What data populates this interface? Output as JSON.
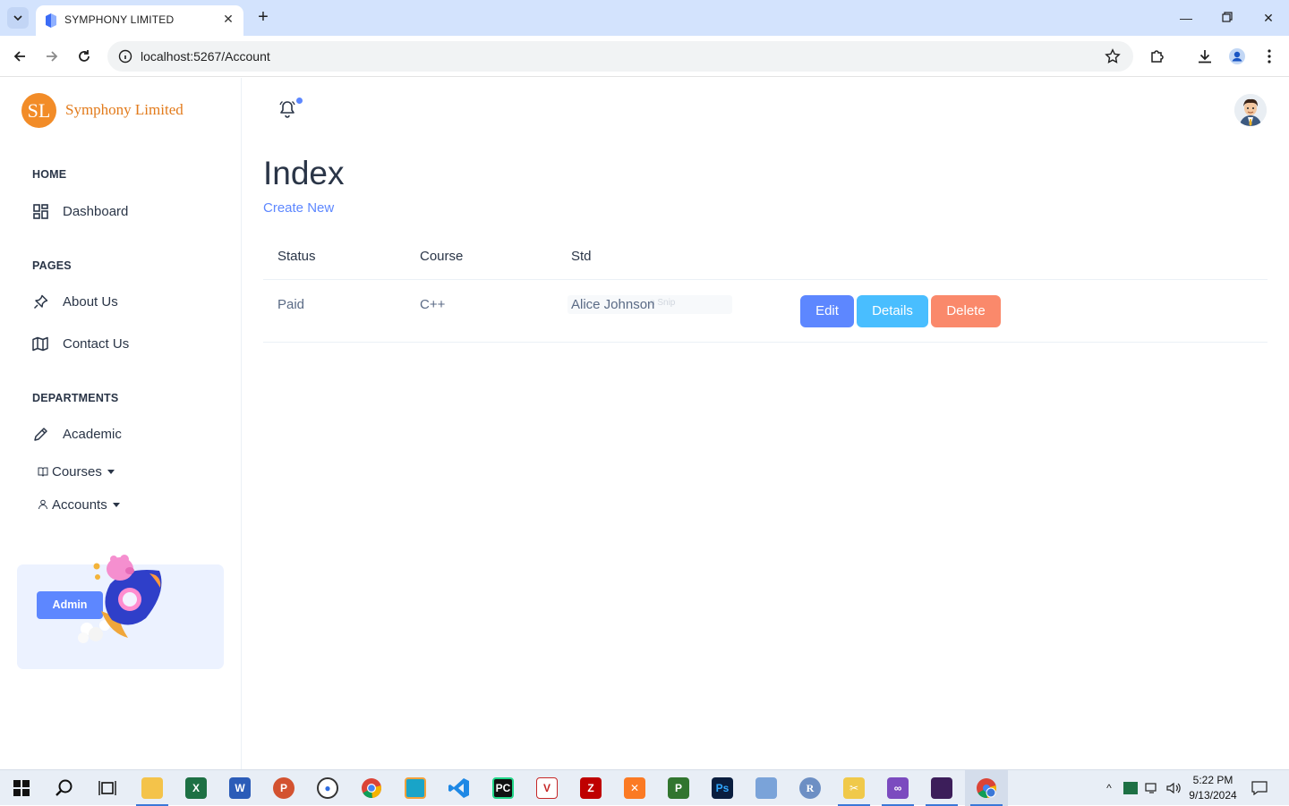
{
  "browser": {
    "tab_title": "SYMPHONY LIMITED",
    "url": "localhost:5267/Account"
  },
  "brand": {
    "initials": "SL",
    "name": "Symphony Limited"
  },
  "sidebar": {
    "sections": [
      {
        "caption": "HOME",
        "items": [
          {
            "label": "Dashboard",
            "icon": "dashboard-icon"
          }
        ]
      },
      {
        "caption": "PAGES",
        "items": [
          {
            "label": "About Us",
            "icon": "pin-icon"
          },
          {
            "label": "Contact Us",
            "icon": "map-icon"
          }
        ]
      },
      {
        "caption": "DEPARTMENTS",
        "items": [
          {
            "label": "Academic",
            "icon": "pencil-icon"
          }
        ]
      }
    ],
    "dropdowns": [
      {
        "label": "Courses",
        "icon": "book-icon"
      },
      {
        "label": "Accounts",
        "icon": "user-icon"
      }
    ],
    "promo_button": "Admin"
  },
  "main": {
    "title": "Index",
    "create_link": "Create New",
    "table": {
      "headers": [
        "Status",
        "Course",
        "Std"
      ],
      "rows": [
        {
          "status": "Paid",
          "course": "C++",
          "std": "Alice Johnson",
          "overlay_text": "n Snip"
        }
      ],
      "actions": {
        "edit": "Edit",
        "details": "Details",
        "delete": "Delete"
      }
    }
  },
  "taskbar": {
    "time": "5:22 PM",
    "date": "9/13/2024"
  },
  "colors": {
    "primary": "#5d87ff",
    "info": "#49beff",
    "danger": "#fa896b",
    "brand_orange": "#f28c28"
  }
}
